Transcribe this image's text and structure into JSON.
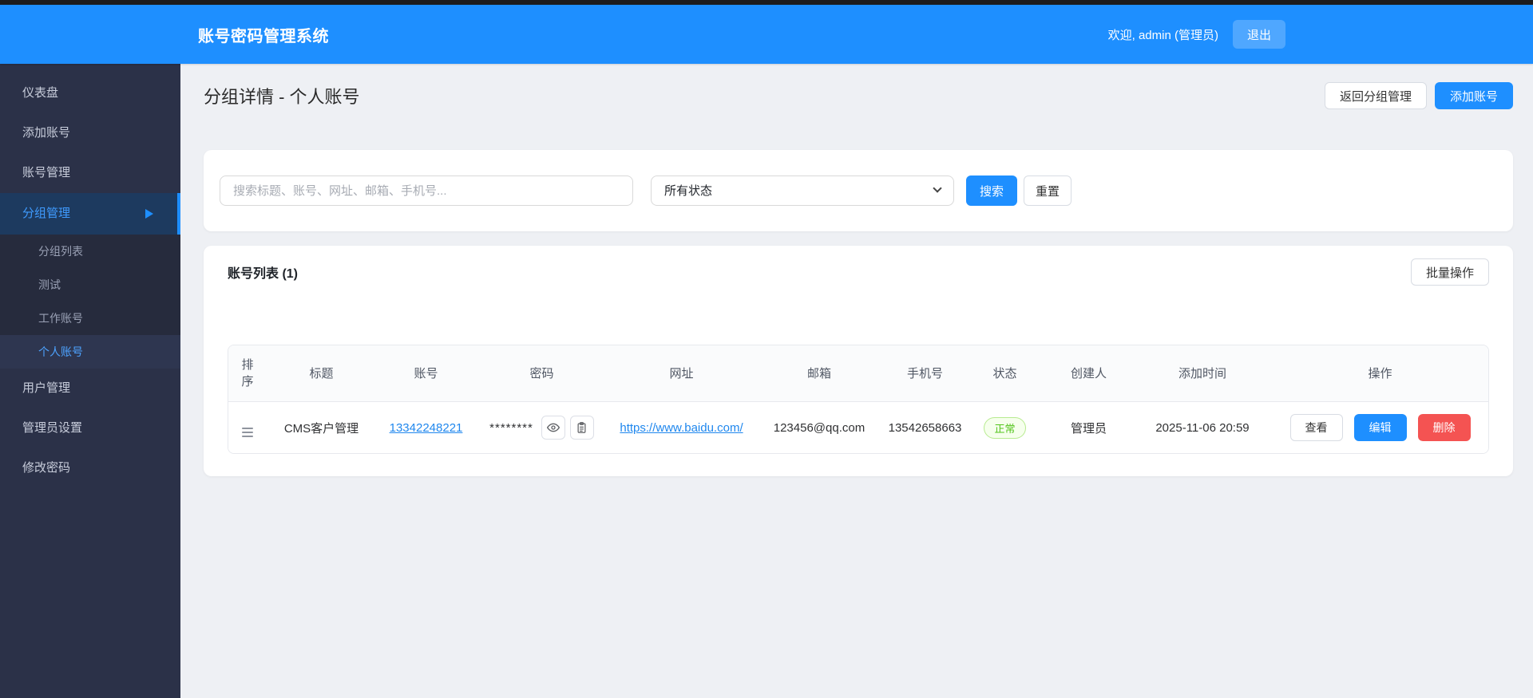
{
  "topbar": {
    "title": "账号密码管理系统",
    "welcome": "欢迎, admin (管理员)",
    "logout_label": "退出"
  },
  "sidebar": {
    "items": [
      {
        "label": "仪表盘"
      },
      {
        "label": "添加账号"
      },
      {
        "label": "账号管理"
      },
      {
        "label": "分组管理",
        "expanded": true
      },
      {
        "label": "用户管理"
      },
      {
        "label": "管理员设置"
      },
      {
        "label": "修改密码"
      }
    ],
    "submenu": [
      {
        "label": "分组列表"
      },
      {
        "label": "测试"
      },
      {
        "label": "工作账号"
      },
      {
        "label": "个人账号",
        "active": true
      }
    ]
  },
  "page": {
    "title": "分组详情 - 个人账号",
    "back_button": "返回分组管理",
    "add_button": "添加账号"
  },
  "search": {
    "placeholder": "搜索标题、账号、网址、邮箱、手机号...",
    "status_filter_value": "所有状态",
    "search_button": "搜索",
    "reset_button": "重置"
  },
  "list": {
    "title": "账号列表 (1)",
    "batch_button": "批量操作",
    "columns": [
      "排序",
      "标题",
      "账号",
      "密码",
      "网址",
      "邮箱",
      "手机号",
      "状态",
      "创建人",
      "添加时间",
      "操作"
    ],
    "row": {
      "title": "CMS客户管理",
      "account": "13342248221",
      "password_masked": "********",
      "url": "https://www.baidu.com/",
      "email": "123456@qq.com",
      "phone": "13542658663",
      "status": "正常",
      "creator": "管理员",
      "created_at": "2025-11-06 20:59",
      "view_button": "查看",
      "edit_button": "编辑",
      "delete_button": "删除"
    }
  },
  "icons": {
    "drag_handle": "hamburger-lines",
    "show_password": "eye",
    "copy_password": "clipboard",
    "group_expanded": "triangle-right",
    "status_dropdown": "chevron-down"
  },
  "colors": {
    "accent": "#1e8fff",
    "danger": "#f45352",
    "success": "#52c41a",
    "success_border": "#b7eb8f",
    "success_bg": "#f6ffed",
    "sidebar_bg": "#2b3148",
    "sidebar_active_bg": "#1d3a5f",
    "header_bg": "#1e8fff",
    "page_bg": "#eef0f4",
    "link": "#1f87ee"
  }
}
